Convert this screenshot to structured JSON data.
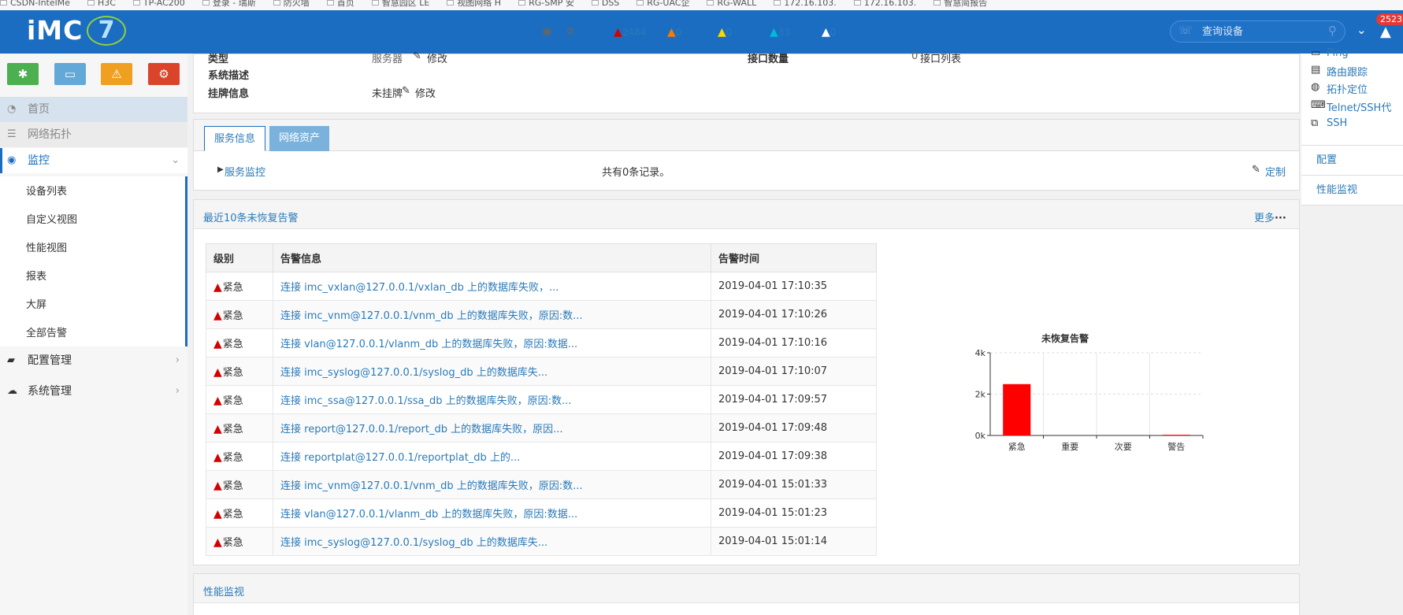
{
  "bookmarks": [
    "CSDN-IntelMe",
    "H3C",
    "TP-AC200",
    "登录 - 瑞斯",
    "防火墙",
    "首页",
    "智慧园区 LE",
    "视图网络 H",
    "RG-SMP 安",
    "DSS",
    "RG-UAC企",
    "RG-WALL",
    "172.16.103.",
    "172.16.103.",
    "智慧简报告"
  ],
  "topbar": {
    "logo_text": "iMC",
    "logo_version": "7",
    "alarm_counts": {
      "critical": "2484",
      "major": "0",
      "minor": "0",
      "warning": "33",
      "info": "0"
    },
    "search_placeholder": "查询设备",
    "badge_count": "2523"
  },
  "colors": {
    "primary": "#1b6dc1",
    "critical": "#d40000",
    "major": "#f57c00",
    "minor": "#ffd600",
    "warning": "#00bcd4",
    "link": "#2a7ab8",
    "btn_green": "#4caf50",
    "btn_blue": "#64a8d8",
    "btn_orange": "#f0a020",
    "btn_red": "#d9442b"
  },
  "sidebar": {
    "items": [
      {
        "label": "首页",
        "icon": "dashboard-icon"
      },
      {
        "label": "网络拓扑",
        "icon": "list-icon"
      },
      {
        "label": "监控",
        "icon": "eye-icon"
      },
      {
        "label": "配置管理",
        "icon": "briefcase-icon"
      },
      {
        "label": "系统管理",
        "icon": "cloud-icon"
      }
    ],
    "sub_items": [
      "设备列表",
      "自定义视图",
      "性能视图",
      "报表",
      "大屏",
      "全部告警"
    ]
  },
  "device_info": {
    "type_label": "类型",
    "type_value": "服务器",
    "type_action": "修改",
    "iface_label": "接口数量",
    "iface_value": "0",
    "iface_action": "接口列表",
    "desc_label": "系统描述",
    "tag_label": "挂牌信息",
    "tag_value": "未挂牌",
    "tag_action": "修改"
  },
  "tabs": [
    {
      "label": "服务信息"
    },
    {
      "label": "网络资产"
    }
  ],
  "service": {
    "monitor_link": "服务监控",
    "record_count": "共有0条记录。",
    "customize": "定制"
  },
  "alarms": {
    "title": "最近10条未恢复告警",
    "more": "更多",
    "columns": [
      "级别",
      "告警信息",
      "告警时间"
    ],
    "rows": [
      {
        "level": "紧急",
        "info": "连接 imc_vxlan@127.0.0.1/vxlan_db 上的数据库失败，...",
        "time": "2019-04-01 17:10:35"
      },
      {
        "level": "紧急",
        "info": "连接 imc_vnm@127.0.0.1/vnm_db 上的数据库失败，原因:数...",
        "time": "2019-04-01 17:10:26"
      },
      {
        "level": "紧急",
        "info": "连接 vlan@127.0.0.1/vlanm_db 上的数据库失败，原因:数据...",
        "time": "2019-04-01 17:10:16"
      },
      {
        "level": "紧急",
        "info": "连接 imc_syslog@127.0.0.1/syslog_db 上的数据库失...",
        "time": "2019-04-01 17:10:07"
      },
      {
        "level": "紧急",
        "info": "连接 imc_ssa@127.0.0.1/ssa_db 上的数据库失败，原因:数...",
        "time": "2019-04-01 17:09:57"
      },
      {
        "level": "紧急",
        "info": "连接 report@127.0.0.1/report_db 上的数据库失败，原因...",
        "time": "2019-04-01 17:09:48"
      },
      {
        "level": "紧急",
        "info": "连接 reportplat@127.0.0.1/reportplat_db 上的...",
        "time": "2019-04-01 17:09:38"
      },
      {
        "level": "紧急",
        "info": "连接 imc_vnm@127.0.0.1/vnm_db 上的数据库失败，原因:数...",
        "time": "2019-04-01 15:01:33"
      },
      {
        "level": "紧急",
        "info": "连接 vlan@127.0.0.1/vlanm_db 上的数据库失败，原因:数据...",
        "time": "2019-04-01 15:01:23"
      },
      {
        "level": "紧急",
        "info": "连接 imc_syslog@127.0.0.1/syslog_db 上的数据库失...",
        "time": "2019-04-01 15:01:14"
      }
    ]
  },
  "chart_data": {
    "type": "bar",
    "title": "未恢复告警",
    "categories": [
      "紧急",
      "重要",
      "次要",
      "警告"
    ],
    "values": [
      2484,
      0,
      0,
      33
    ],
    "yticks": [
      "0k",
      "2k",
      "4k"
    ],
    "ylim": [
      0,
      4000
    ],
    "grid": true,
    "bar_color": "#ff0000"
  },
  "perf_panel": {
    "title": "性能监视"
  },
  "right_panel": {
    "tools": [
      {
        "label": "Ping",
        "icon": "monitor-icon"
      },
      {
        "label": "路由跟踪",
        "icon": "route-icon"
      },
      {
        "label": "拓扑定位",
        "icon": "globe-icon"
      },
      {
        "label": "Telnet/SSH代",
        "icon": "terminal-icon"
      },
      {
        "label": "SSH",
        "icon": "ssh-icon"
      }
    ],
    "links": [
      "配置",
      "性能监视"
    ]
  }
}
